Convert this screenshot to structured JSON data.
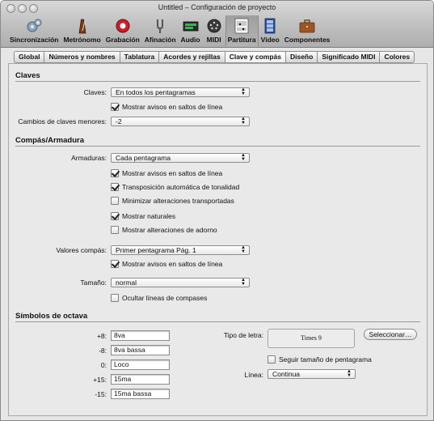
{
  "window": {
    "title": "Untitled – Configuración de proyecto"
  },
  "toolbar": {
    "items": [
      {
        "label": "Sincronización",
        "icon": "gears-icon"
      },
      {
        "label": "Metrónomo",
        "icon": "metronome-icon"
      },
      {
        "label": "Grabación",
        "icon": "record-icon"
      },
      {
        "label": "Afinación",
        "icon": "tuning-fork-icon"
      },
      {
        "label": "Audio",
        "icon": "audio-meter-icon"
      },
      {
        "label": "MIDI",
        "icon": "midi-plug-icon"
      },
      {
        "label": "Partitura",
        "icon": "score-icon"
      },
      {
        "label": "Vídeo",
        "icon": "film-icon"
      },
      {
        "label": "Componentes",
        "icon": "briefcase-icon"
      }
    ],
    "selected": "Partitura"
  },
  "tabs": [
    "Global",
    "Números y nombres",
    "Tablatura",
    "Acordes y rejillas",
    "Clave y compás",
    "Diseño",
    "Significado MIDI",
    "Colores"
  ],
  "active_tab": "Clave y compás",
  "claves": {
    "section_title": "Claves",
    "claves_label": "Claves:",
    "claves_value": "En todos los pentagramas",
    "warn_line_breaks": {
      "label": "Mostrar avisos en saltos de línea",
      "checked": true
    },
    "minor_changes_label": "Cambios de claves menores:",
    "minor_changes_value": "-2"
  },
  "compas": {
    "section_title": "Compás/Armadura",
    "armaduras_label": "Armaduras:",
    "armaduras_value": "Cada pentagrama",
    "checks": [
      {
        "label": "Mostrar avisos en saltos de línea",
        "checked": true
      },
      {
        "label": "Transposición automática de tonalidad",
        "checked": true
      },
      {
        "label": "Minimizar alteraciones transportadas",
        "checked": false
      },
      {
        "label": "Mostrar naturales",
        "checked": true
      },
      {
        "label": "Mostrar alteraciones de adorno",
        "checked": false
      }
    ],
    "valores_label": "Valores compás:",
    "valores_value": "Primer pentagrama Pág. 1",
    "valores_warn": {
      "label": "Mostrar avisos en saltos de línea",
      "checked": true
    },
    "tamano_label": "Tamaño:",
    "tamano_value": "normal",
    "hide_bar_lines": {
      "label": "Ocultar líneas de compases",
      "checked": false
    }
  },
  "octava": {
    "section_title": "Símbolos de octava",
    "rows": [
      {
        "label": "+8:",
        "value": "8va"
      },
      {
        "label": "-8:",
        "value": "8va bassa"
      },
      {
        "label": "0:",
        "value": "Loco"
      },
      {
        "label": "+15:",
        "value": "15ma"
      },
      {
        "label": "-15:",
        "value": "15ma bassa"
      }
    ],
    "font_label": "Tipo de letra:",
    "font_preview": "Times 9",
    "select_button": "Seleccionar…",
    "follow_staff_size": {
      "label": "Seguir tamaño de pentagrama",
      "checked": false
    },
    "line_label": "Línea:",
    "line_value": "Continua"
  }
}
